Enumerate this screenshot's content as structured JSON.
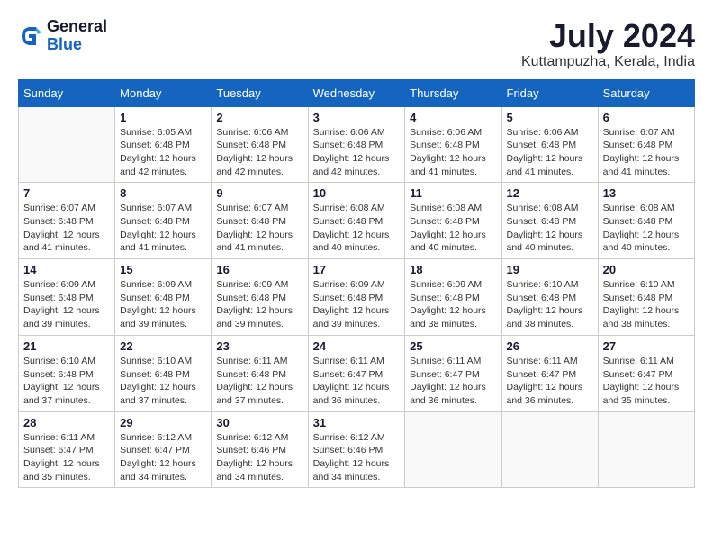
{
  "header": {
    "logo_general": "General",
    "logo_blue": "Blue",
    "month_title": "July 2024",
    "location": "Kuttampuzha, Kerala, India"
  },
  "calendar": {
    "days_of_week": [
      "Sunday",
      "Monday",
      "Tuesday",
      "Wednesday",
      "Thursday",
      "Friday",
      "Saturday"
    ],
    "weeks": [
      [
        {
          "day": "",
          "info": ""
        },
        {
          "day": "1",
          "info": "Sunrise: 6:05 AM\nSunset: 6:48 PM\nDaylight: 12 hours\nand 42 minutes."
        },
        {
          "day": "2",
          "info": "Sunrise: 6:06 AM\nSunset: 6:48 PM\nDaylight: 12 hours\nand 42 minutes."
        },
        {
          "day": "3",
          "info": "Sunrise: 6:06 AM\nSunset: 6:48 PM\nDaylight: 12 hours\nand 42 minutes."
        },
        {
          "day": "4",
          "info": "Sunrise: 6:06 AM\nSunset: 6:48 PM\nDaylight: 12 hours\nand 41 minutes."
        },
        {
          "day": "5",
          "info": "Sunrise: 6:06 AM\nSunset: 6:48 PM\nDaylight: 12 hours\nand 41 minutes."
        },
        {
          "day": "6",
          "info": "Sunrise: 6:07 AM\nSunset: 6:48 PM\nDaylight: 12 hours\nand 41 minutes."
        }
      ],
      [
        {
          "day": "7",
          "info": ""
        },
        {
          "day": "8",
          "info": "Sunrise: 6:07 AM\nSunset: 6:48 PM\nDaylight: 12 hours\nand 41 minutes."
        },
        {
          "day": "9",
          "info": "Sunrise: 6:07 AM\nSunset: 6:48 PM\nDaylight: 12 hours\nand 41 minutes."
        },
        {
          "day": "10",
          "info": "Sunrise: 6:08 AM\nSunset: 6:48 PM\nDaylight: 12 hours\nand 40 minutes."
        },
        {
          "day": "11",
          "info": "Sunrise: 6:08 AM\nSunset: 6:48 PM\nDaylight: 12 hours\nand 40 minutes."
        },
        {
          "day": "12",
          "info": "Sunrise: 6:08 AM\nSunset: 6:48 PM\nDaylight: 12 hours\nand 40 minutes."
        },
        {
          "day": "13",
          "info": "Sunrise: 6:08 AM\nSunset: 6:48 PM\nDaylight: 12 hours\nand 40 minutes."
        }
      ],
      [
        {
          "day": "14",
          "info": ""
        },
        {
          "day": "15",
          "info": "Sunrise: 6:09 AM\nSunset: 6:48 PM\nDaylight: 12 hours\nand 39 minutes."
        },
        {
          "day": "16",
          "info": "Sunrise: 6:09 AM\nSunset: 6:48 PM\nDaylight: 12 hours\nand 39 minutes."
        },
        {
          "day": "17",
          "info": "Sunrise: 6:09 AM\nSunset: 6:48 PM\nDaylight: 12 hours\nand 39 minutes."
        },
        {
          "day": "18",
          "info": "Sunrise: 6:09 AM\nSunset: 6:48 PM\nDaylight: 12 hours\nand 38 minutes."
        },
        {
          "day": "19",
          "info": "Sunrise: 6:10 AM\nSunset: 6:48 PM\nDaylight: 12 hours\nand 38 minutes."
        },
        {
          "day": "20",
          "info": "Sunrise: 6:10 AM\nSunset: 6:48 PM\nDaylight: 12 hours\nand 38 minutes."
        }
      ],
      [
        {
          "day": "21",
          "info": ""
        },
        {
          "day": "22",
          "info": "Sunrise: 6:10 AM\nSunset: 6:48 PM\nDaylight: 12 hours\nand 37 minutes."
        },
        {
          "day": "23",
          "info": "Sunrise: 6:11 AM\nSunset: 6:48 PM\nDaylight: 12 hours\nand 37 minutes."
        },
        {
          "day": "24",
          "info": "Sunrise: 6:11 AM\nSunset: 6:47 PM\nDaylight: 12 hours\nand 36 minutes."
        },
        {
          "day": "25",
          "info": "Sunrise: 6:11 AM\nSunset: 6:47 PM\nDaylight: 12 hours\nand 36 minutes."
        },
        {
          "day": "26",
          "info": "Sunrise: 6:11 AM\nSunset: 6:47 PM\nDaylight: 12 hours\nand 36 minutes."
        },
        {
          "day": "27",
          "info": "Sunrise: 6:11 AM\nSunset: 6:47 PM\nDaylight: 12 hours\nand 35 minutes."
        }
      ],
      [
        {
          "day": "28",
          "info": "Sunrise: 6:11 AM\nSunset: 6:47 PM\nDaylight: 12 hours\nand 35 minutes."
        },
        {
          "day": "29",
          "info": "Sunrise: 6:12 AM\nSunset: 6:47 PM\nDaylight: 12 hours\nand 34 minutes."
        },
        {
          "day": "30",
          "info": "Sunrise: 6:12 AM\nSunset: 6:46 PM\nDaylight: 12 hours\nand 34 minutes."
        },
        {
          "day": "31",
          "info": "Sunrise: 6:12 AM\nSunset: 6:46 PM\nDaylight: 12 hours\nand 34 minutes."
        },
        {
          "day": "",
          "info": ""
        },
        {
          "day": "",
          "info": ""
        },
        {
          "day": "",
          "info": ""
        }
      ]
    ],
    "week7_first_day": "Sunrise: 6:07 AM\nSunset: 6:48 PM\nDaylight: 12 hours\nand 41 minutes.",
    "week14_first_day": "Sunrise: 6:09 AM\nSunset: 6:48 PM\nDaylight: 12 hours\nand 39 minutes.",
    "week21_first_day": "Sunrise: 6:10 AM\nSunset: 6:48 PM\nDaylight: 12 hours\nand 37 minutes."
  }
}
